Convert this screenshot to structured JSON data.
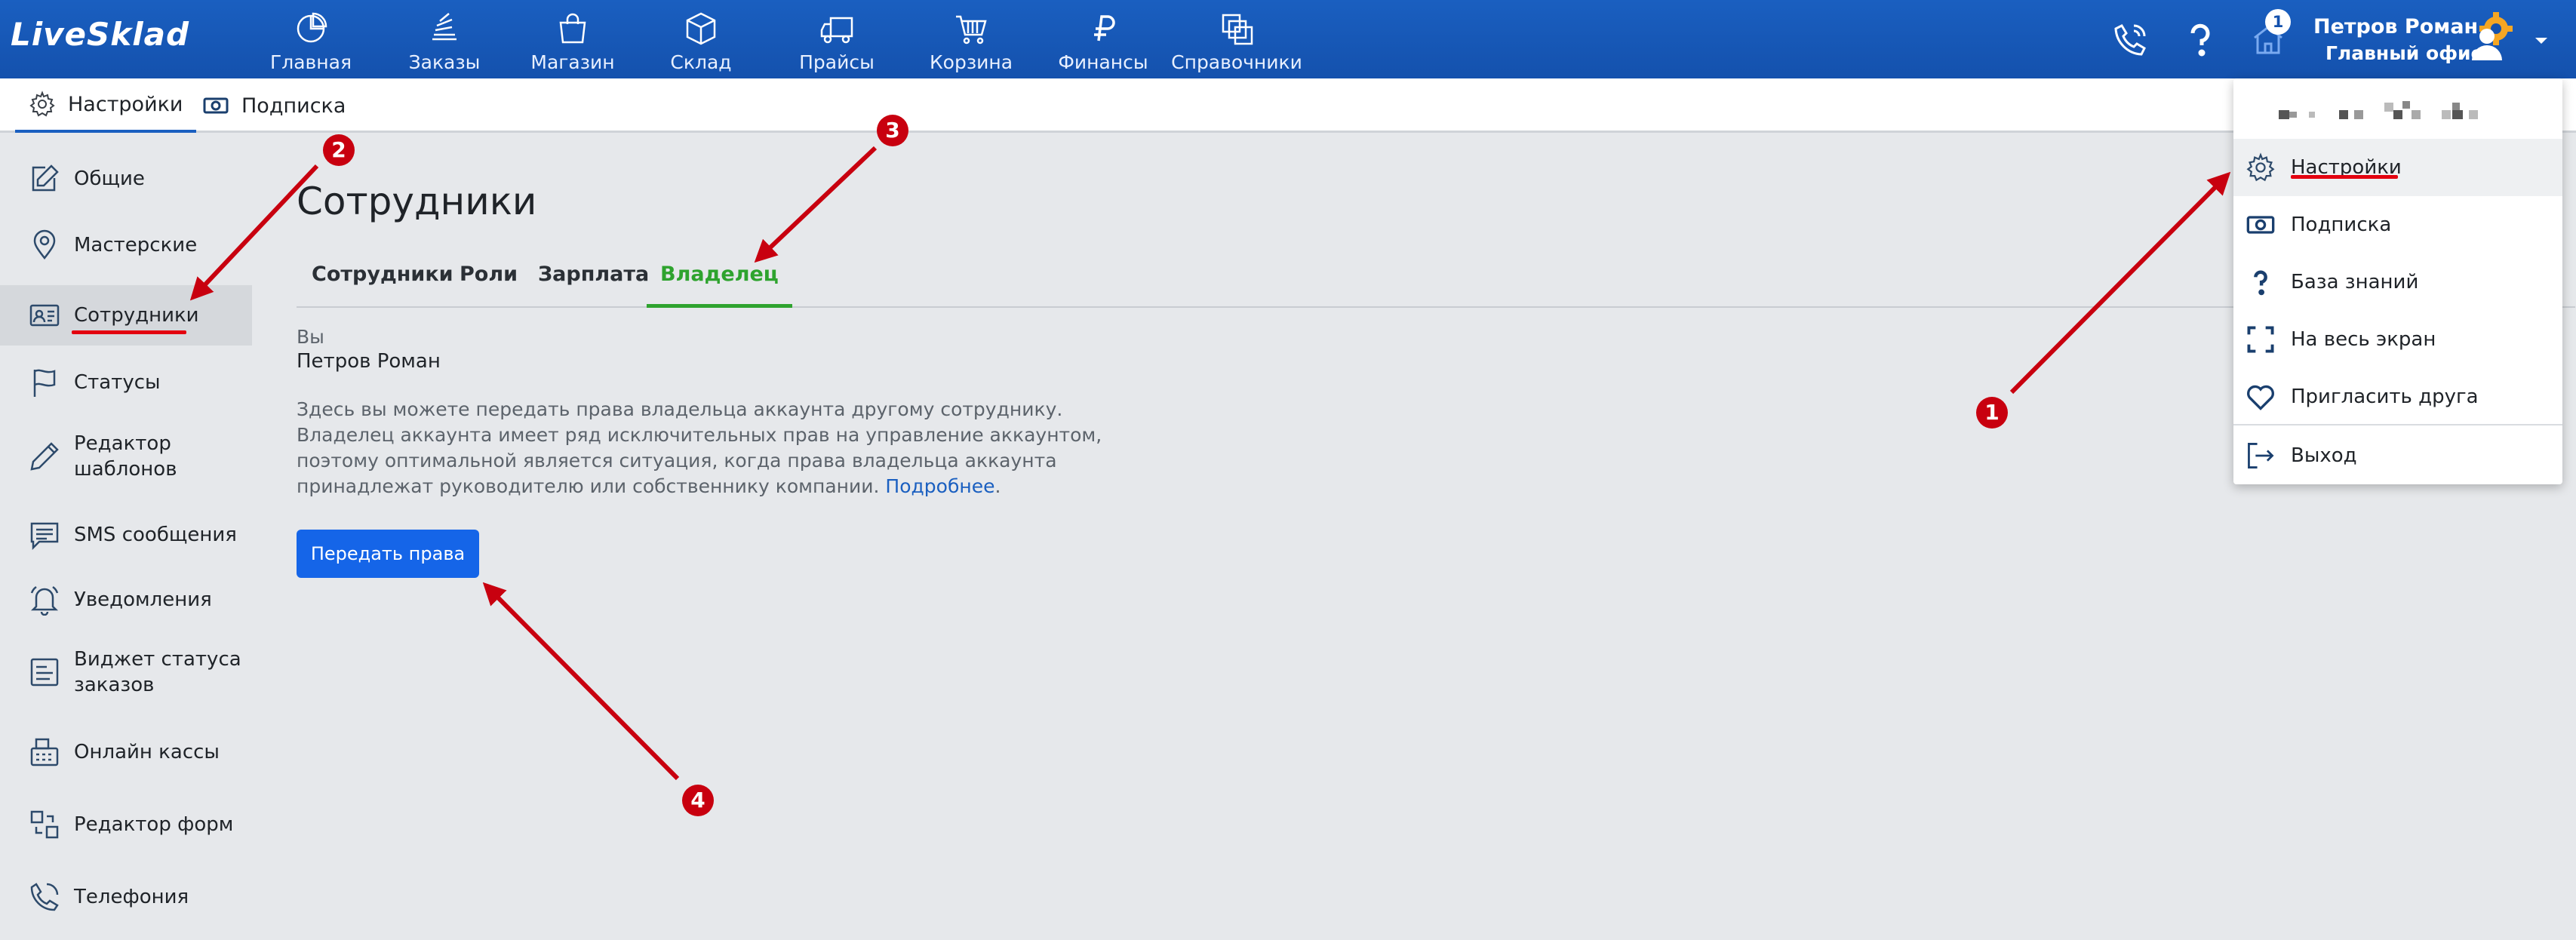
{
  "app": {
    "logo": "LiveSklad"
  },
  "nav": [
    {
      "label": "Главная",
      "icon": "pie-chart-icon"
    },
    {
      "label": "Заказы",
      "icon": "stack-icon"
    },
    {
      "label": "Магазин",
      "icon": "shopping-bag-icon"
    },
    {
      "label": "Склад",
      "icon": "box-icon"
    },
    {
      "label": "Прайсы",
      "icon": "truck-icon"
    },
    {
      "label": "Корзина",
      "icon": "cart-icon"
    },
    {
      "label": "Финансы",
      "icon": "ruble-icon"
    },
    {
      "label": "Справочники",
      "icon": "layers-icon"
    }
  ],
  "header": {
    "notification_count": "1",
    "user_name": "Петров Роман",
    "user_office": "Главный офис"
  },
  "subbar": {
    "tabs": [
      {
        "label": "Настройки",
        "icon": "gear-icon",
        "active": true
      },
      {
        "label": "Подписка",
        "icon": "banknote-icon",
        "active": false
      }
    ]
  },
  "sidebar": {
    "items": [
      {
        "label": "Общие",
        "icon": "edit-icon"
      },
      {
        "label": "Мастерские",
        "icon": "location-pin-icon"
      },
      {
        "label": "Сотрудники",
        "icon": "id-card-icon",
        "active": true
      },
      {
        "label": "Статусы",
        "icon": "flag-icon"
      },
      {
        "label": "Редактор шаблонов",
        "icon": "pencil-icon"
      },
      {
        "label": "SMS сообщения",
        "icon": "message-icon"
      },
      {
        "label": "Уведомления",
        "icon": "bell-icon"
      },
      {
        "label": "Виджет статуса заказов",
        "icon": "widget-icon"
      },
      {
        "label": "Онлайн кассы",
        "icon": "cash-register-icon"
      },
      {
        "label": "Редактор форм",
        "icon": "form-editor-icon"
      },
      {
        "label": "Телефония",
        "icon": "phone-icon"
      }
    ]
  },
  "main": {
    "title": "Сотрудники",
    "tabs": [
      {
        "label": "Сотрудники",
        "active": false
      },
      {
        "label": "Роли",
        "active": false
      },
      {
        "label": "Зарплата",
        "active": false
      },
      {
        "label": "Владелец",
        "active": true
      }
    ],
    "you_label": "Вы",
    "you_name": "Петров Роман",
    "description": "Здесь вы можете передать права владельца аккаунта другому сотруднику. Владелец аккаунта имеет ряд исключительных прав на управление аккаунтом, поэтому оптимальной является ситуация, когда права владельца аккаунта принадлежат руководителю или собственнику компании.",
    "more_link": "Подробнее",
    "transfer_button": "Передать права"
  },
  "dropdown": {
    "items": [
      {
        "label": "Настройки",
        "icon": "gear-icon",
        "active": true
      },
      {
        "label": "Подписка",
        "icon": "banknote-icon"
      },
      {
        "label": "База знаний",
        "icon": "question-icon"
      },
      {
        "label": "На весь экран",
        "icon": "fullscreen-icon"
      },
      {
        "label": "Пригласить друга",
        "icon": "heart-icon"
      },
      {
        "label": "Выход",
        "icon": "logout-icon"
      }
    ]
  },
  "annotations": [
    "1",
    "2",
    "3",
    "4"
  ],
  "colors": {
    "topbar": "#1451ad",
    "accent_green": "#2ea32e",
    "button_blue": "#1565e8",
    "annotation_red": "#c8000f"
  }
}
